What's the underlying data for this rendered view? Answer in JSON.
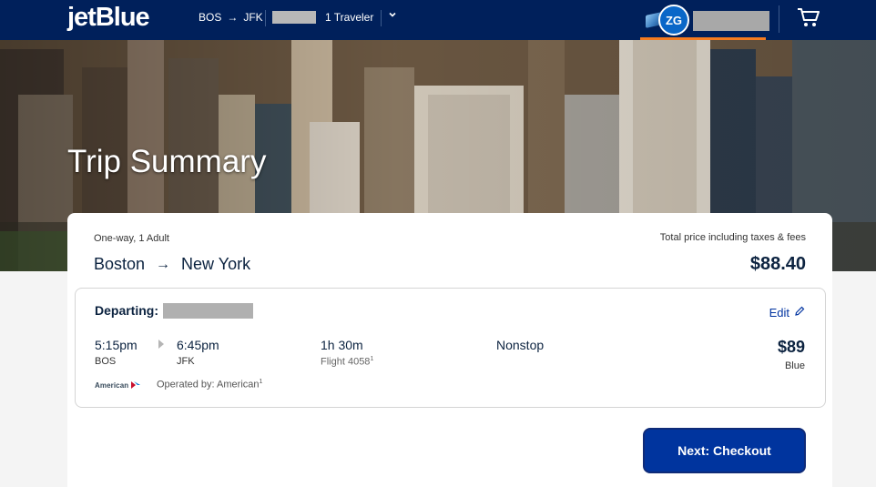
{
  "header": {
    "logo": "jetBlue",
    "route_from": "BOS",
    "route_arrow": "→",
    "route_to": "JFK",
    "travelers": "1 Traveler",
    "dropdown_icon": "chevron-down-icon",
    "avatar_initials": "ZG",
    "cart_icon": "cart-icon",
    "colors": {
      "bar": "#00205b",
      "underline": "#f47b20",
      "avatar": "#0a67c8"
    }
  },
  "hero": {
    "title": "Trip Summary"
  },
  "summary": {
    "trip_type": "One-way,",
    "adults": "1 Adult",
    "origin": "Boston",
    "arrow": "→",
    "destination": "New York",
    "total_label": "Total price including taxes & fees",
    "total_price": "$88.40"
  },
  "segment": {
    "label": "Departing:",
    "edit_label": "Edit",
    "depart_time": "5:15pm",
    "depart_airport": "BOS",
    "arrive_time": "6:45pm",
    "arrive_airport": "JFK",
    "duration": "1h 30m",
    "flight": "Flight 4058",
    "flight_note": "1",
    "stops": "Nonstop",
    "fare": "$89",
    "fare_class": "Blue",
    "carrier_logo_text": "American",
    "operated_by": "Operated by: American",
    "operated_note": "1"
  },
  "actions": {
    "checkout_label": "Next: Checkout",
    "checkout_color": "#00349e"
  }
}
